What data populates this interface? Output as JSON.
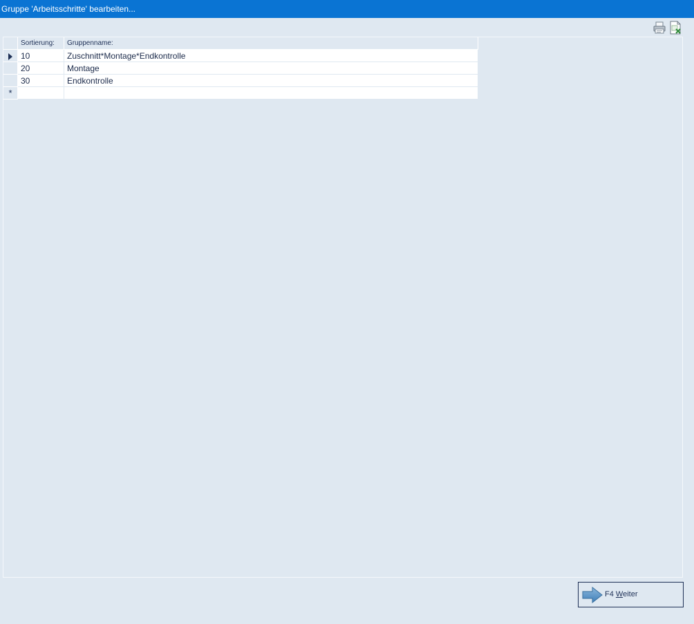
{
  "window": {
    "title": "Gruppe 'Arbeitsschritte' bearbeiten..."
  },
  "toolbar": {
    "icons": [
      "printer-icon",
      "export-excel-icon"
    ]
  },
  "grid": {
    "columns": [
      "Sortierung:",
      "Gruppenname:"
    ],
    "rows": [
      {
        "indicator": "current",
        "sort": "10",
        "name": "Zuschnitt*Montage*Endkontrolle"
      },
      {
        "indicator": "",
        "sort": "20",
        "name": "Montage"
      },
      {
        "indicator": "",
        "sort": "30",
        "name": "Endkontrolle"
      }
    ],
    "new_row_marker": "*"
  },
  "footer": {
    "next_key": "F4 ",
    "next_accel": "W",
    "next_rest": "eiter"
  },
  "colors": {
    "titlebar": "#0a74d3",
    "background": "#dfe8f1",
    "text": "#1b2a4a"
  }
}
